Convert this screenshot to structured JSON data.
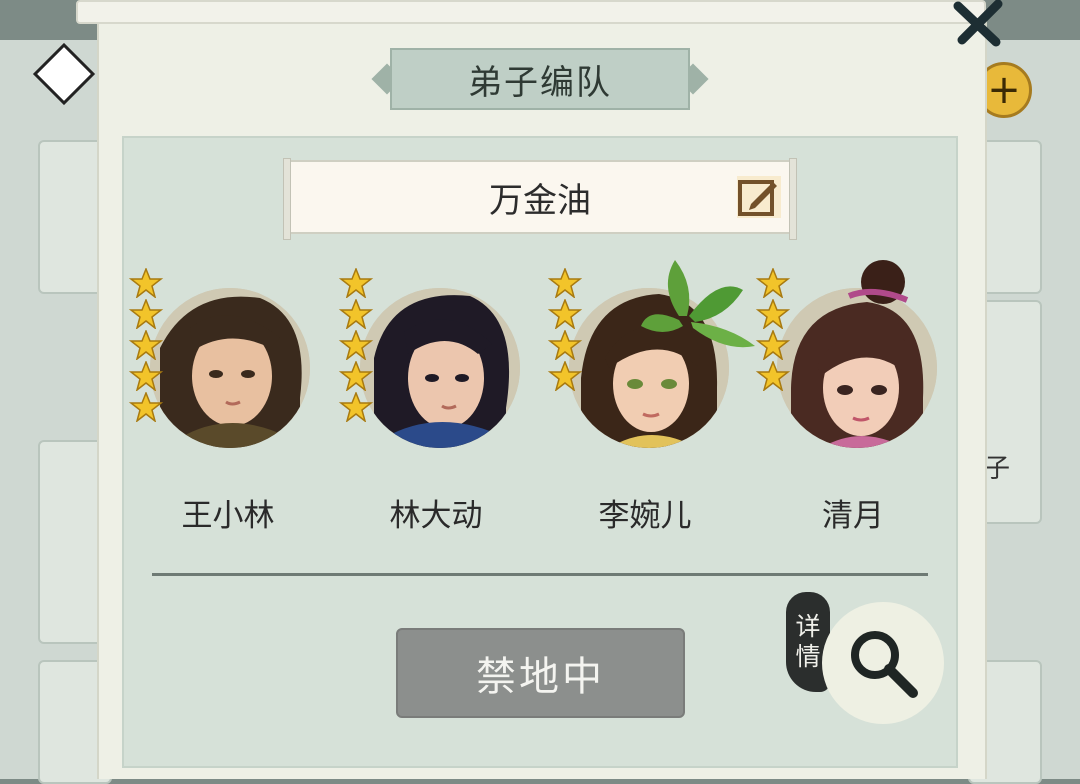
{
  "dialog": {
    "title": "弟子编队",
    "team_name": "万金油",
    "status_button_label": "禁地中",
    "detail_label_line1": "详",
    "detail_label_line2": "情"
  },
  "members": [
    {
      "name": "王小林",
      "stars": 5,
      "hair": "#3a2a1d",
      "skin": "#e8c0a0",
      "outfit": "#5a4a2a"
    },
    {
      "name": "林大动",
      "stars": 5,
      "hair": "#1f1a26",
      "skin": "#ecc6ae",
      "outfit": "#2b4a8a"
    },
    {
      "name": "李婉儿",
      "stars": 4,
      "hair": "#3b2618",
      "skin": "#f1cdb2",
      "outfit": "#e2c25a"
    },
    {
      "name": "清月",
      "stars": 4,
      "hair": "#4a2a22",
      "skin": "#f2cdb8",
      "outfit": "#c86a9a"
    }
  ],
  "background": {
    "partial_text": "子"
  },
  "colors": {
    "panel": "#eef0e6",
    "inner": "#d6e1d8",
    "star": "#f2c42a",
    "button_disabled": "#8c8f8d"
  }
}
